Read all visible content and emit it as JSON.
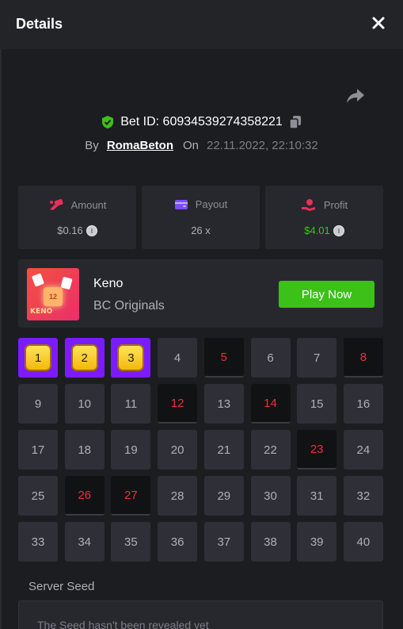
{
  "header": {
    "title": "Details"
  },
  "bet": {
    "id_text": "Bet ID: 60934539274358221",
    "by_label": "By",
    "username": "RomaBeton",
    "on_label": "On",
    "datetime": "22.11.2022, 22:10:32"
  },
  "stats": {
    "amount": {
      "label": "Amount",
      "value": "$0.16",
      "icon": "amount-icon",
      "color": "#e8305a"
    },
    "payout": {
      "label": "Payout",
      "value": "26 x",
      "icon": "wallet-icon",
      "color": "#7c4dff"
    },
    "profit": {
      "label": "Profit",
      "value": "$4.01",
      "icon": "profit-icon",
      "color": "#e8305a",
      "value_color": "#3bc117"
    }
  },
  "game": {
    "name": "Keno",
    "provider": "BC Originals",
    "thumb_ball": "12",
    "thumb_label": "KENO",
    "play_label": "Play Now",
    "play_color": "#3bc117"
  },
  "grid": {
    "numbers": [
      "1",
      "2",
      "3",
      "4",
      "5",
      "6",
      "7",
      "8",
      "9",
      "10",
      "11",
      "12",
      "13",
      "14",
      "15",
      "16",
      "17",
      "18",
      "19",
      "20",
      "21",
      "22",
      "23",
      "24",
      "25",
      "26",
      "27",
      "28",
      "29",
      "30",
      "31",
      "32",
      "33",
      "34",
      "35",
      "36",
      "37",
      "38",
      "39",
      "40"
    ],
    "matched": [
      "1",
      "2",
      "3"
    ],
    "drawn": [
      "5",
      "8",
      "12",
      "14",
      "23",
      "26",
      "27"
    ],
    "match_color": "#7c1bff",
    "drawn_color": "#e6323e"
  },
  "seed": {
    "label": "Server Seed",
    "text": "The Seed hasn't been revealed yet"
  }
}
